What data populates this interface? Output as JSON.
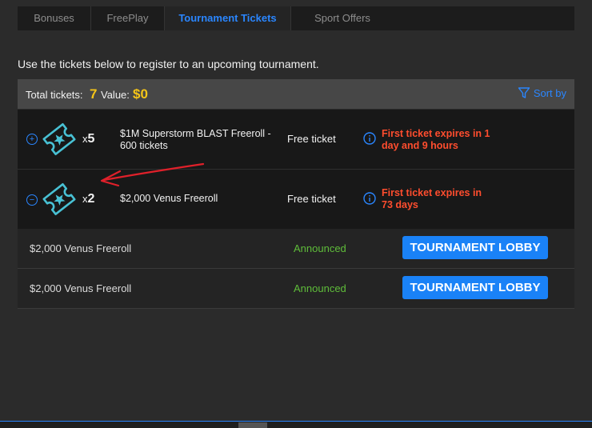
{
  "tabs": [
    {
      "label": "Bonuses",
      "active": false
    },
    {
      "label": "FreePlay",
      "active": false
    },
    {
      "label": "Tournament Tickets",
      "active": true
    },
    {
      "label": "Sport Offers",
      "active": false
    }
  ],
  "intro_text": "Use the tickets below to register to an upcoming tournament.",
  "summary": {
    "total_label": "Total tickets:",
    "total_value": "7",
    "value_label": "Value:",
    "value_amount": "$0",
    "sort_label": "Sort by"
  },
  "tickets": [
    {
      "toggle": "+",
      "count_prefix": "x",
      "count": "5",
      "name_line1": "$1M Superstorm BLAST Freeroll -",
      "name_line2": "600 tickets",
      "type": "Free ticket",
      "expiry_line1": "First ticket expires in 1",
      "expiry_line2": "day and 9 hours",
      "expanded": false
    },
    {
      "toggle": "−",
      "count_prefix": "x",
      "count": "2",
      "name_line1": "$2,000 Venus Freeroll",
      "type": "Free ticket",
      "expiry_line1": "First ticket expires in",
      "expiry_line2": "73 days",
      "expanded": true
    }
  ],
  "sub_rows": [
    {
      "name": "$2,000 Venus Freeroll",
      "status": "Announced",
      "button": "TOURNAMENT LOBBY"
    },
    {
      "name": "$2,000 Venus Freeroll",
      "status": "Announced",
      "button": "TOURNAMENT LOBBY"
    }
  ],
  "colors": {
    "accent": "#2a86ff",
    "highlight": "#f5c518",
    "expiry": "#ff4d2e",
    "status_ok": "#5fbd3a",
    "button": "#1a82f7",
    "annotation_arrow": "#e0202a"
  }
}
